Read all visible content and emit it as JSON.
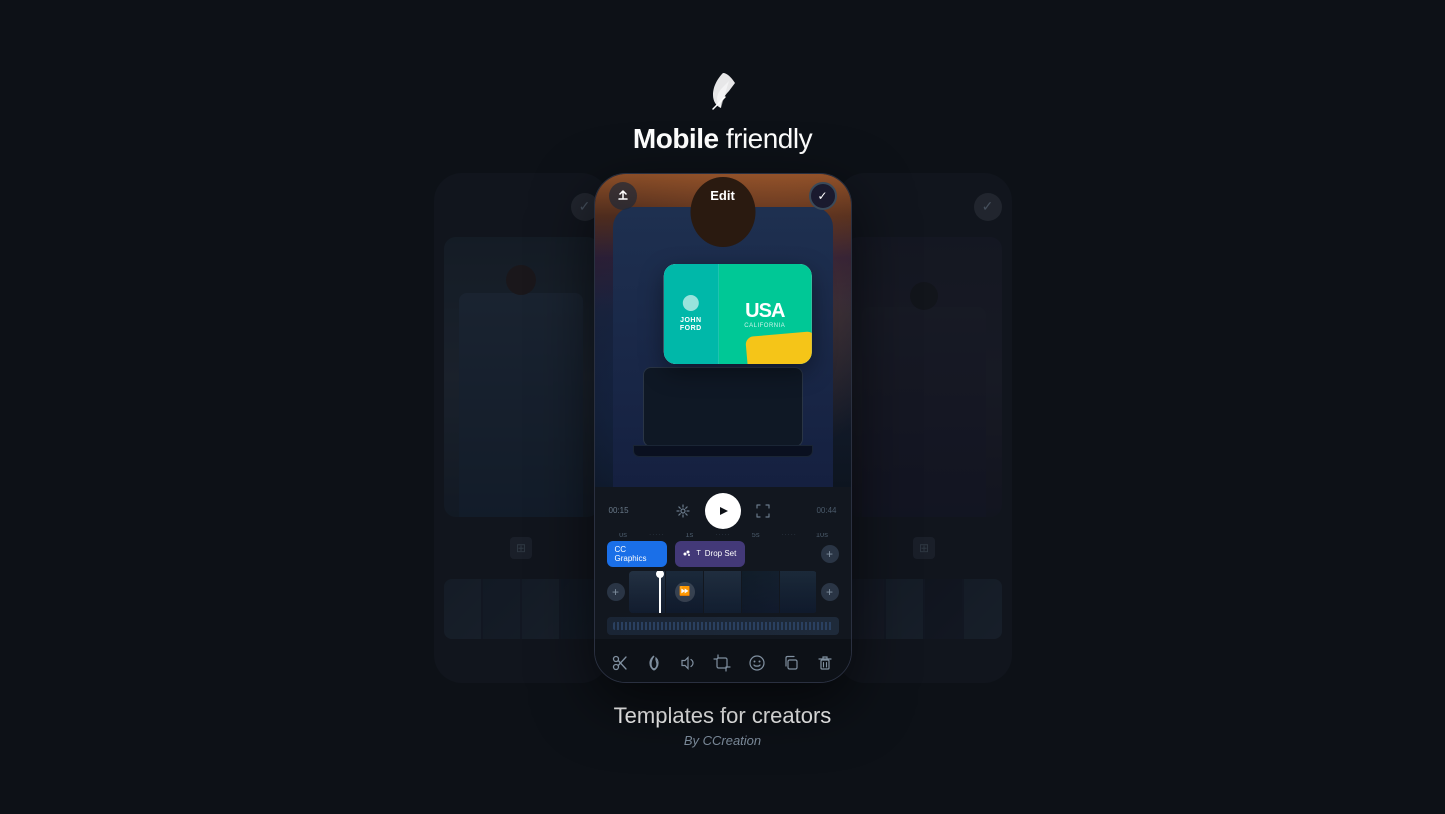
{
  "header": {
    "logo_alt": "feather-icon",
    "title_bold": "Mobile",
    "title_regular": " friendly"
  },
  "phone_edit_label": "Edit",
  "timeline": {
    "current_time": "00:15",
    "total_time": "00:44",
    "markers": [
      "0s",
      "1s",
      "5s",
      "10s"
    ]
  },
  "tracks": {
    "graphics_label": "CC Graphics",
    "dropset_label": "Drop Set"
  },
  "bottom_toolbar": {
    "icons": [
      "scissors",
      "flame",
      "volume",
      "crop",
      "emoji",
      "copy",
      "trash"
    ]
  },
  "footer": {
    "main_text": "Templates for creators",
    "sub_text": "By CCreation"
  },
  "side_phones": {
    "left_check": "✓",
    "right_check": "✓"
  }
}
